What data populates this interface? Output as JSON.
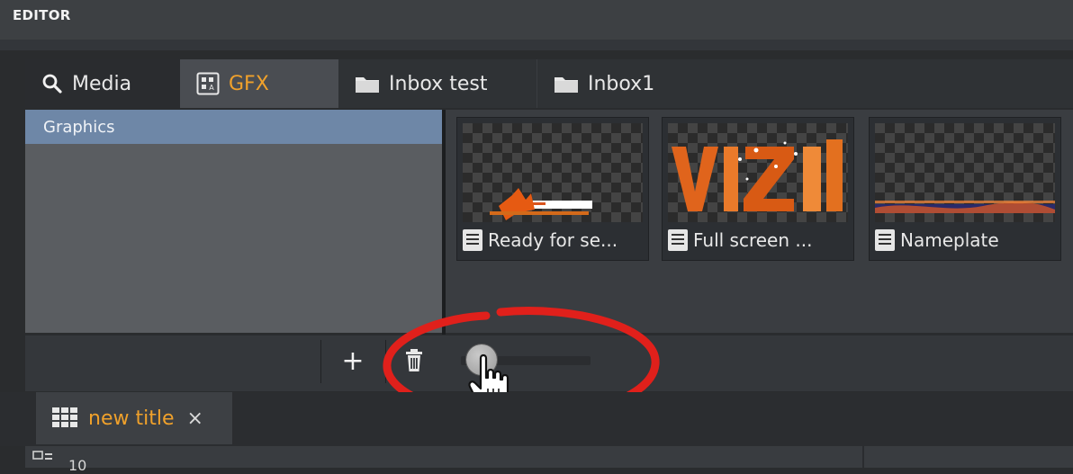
{
  "window": {
    "title": "EDITOR"
  },
  "tabs": [
    {
      "label": "Media",
      "icon": "search-icon"
    },
    {
      "label": "GFX",
      "icon": "gfx-icon",
      "active": true
    },
    {
      "label": "Inbox test",
      "icon": "folder-icon"
    },
    {
      "label": "Inbox1",
      "icon": "folder-icon"
    }
  ],
  "sidebar": {
    "items": [
      {
        "label": "Graphics",
        "selected": true
      }
    ]
  },
  "thumbnails": [
    {
      "label": "Ready for se...",
      "icon": "document-icon"
    },
    {
      "label": "Full screen ...",
      "icon": "document-icon"
    },
    {
      "label": "Nameplate",
      "icon": "document-icon"
    }
  ],
  "toolbar": {
    "add_label": "+",
    "delete_icon": "trash-icon",
    "zoom_slider_value": 0.1
  },
  "title_tabs": [
    {
      "label": "new title",
      "close_label": "×",
      "icon": "grid-icon"
    }
  ],
  "bottom_strip": {
    "count": "10"
  },
  "colors": {
    "accent": "#f0a12b",
    "selected": "#6e87a7",
    "annotation": "#e0201b"
  }
}
